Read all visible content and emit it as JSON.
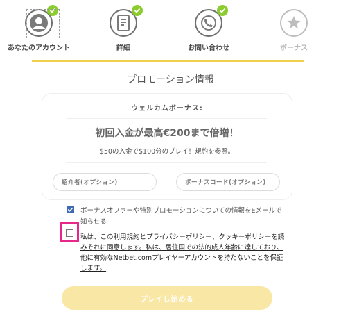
{
  "steps": [
    {
      "label": "あなたのアカウント",
      "icon": "user-icon",
      "status": "done"
    },
    {
      "label": "詳細",
      "icon": "form-icon",
      "status": "done"
    },
    {
      "label": "お問い合わせ",
      "icon": "phone-icon",
      "status": "done"
    },
    {
      "label": "ボーナス",
      "icon": "star-icon",
      "status": "inactive"
    }
  ],
  "colors": {
    "accent": "#f2cf4b",
    "check": "#8ccc2f",
    "highlight": "#e8278c",
    "checkbox": "#3e6ab3"
  },
  "promo": {
    "title": "プロモーション情報",
    "welcome_heading": "ウェルカムボーナス:",
    "offer": "初回入金が最高€200まで倍増！",
    "offer_sub": "$50の入金で$100分のプレイ！規約を参照。"
  },
  "inputs": {
    "referrer_placeholder": "紹介者(オプション)",
    "bonus_code_placeholder": "ボーナスコード(オプション)"
  },
  "consents": {
    "marketing": {
      "text": "ボーナスオファーや特別プロモーションについての情報をEメールで知らせる",
      "checked": true
    },
    "terms": {
      "text": "私は、この利用規約とプライバシーポリシー、クッキーポリシーを読みそれに同意します。私は、居住国での法的成人年齢に達しており、他に有効なNetbet.comプレイヤーアカウントを持たないことを保証します。",
      "checked": false
    }
  },
  "play_button": "プレイし始める"
}
